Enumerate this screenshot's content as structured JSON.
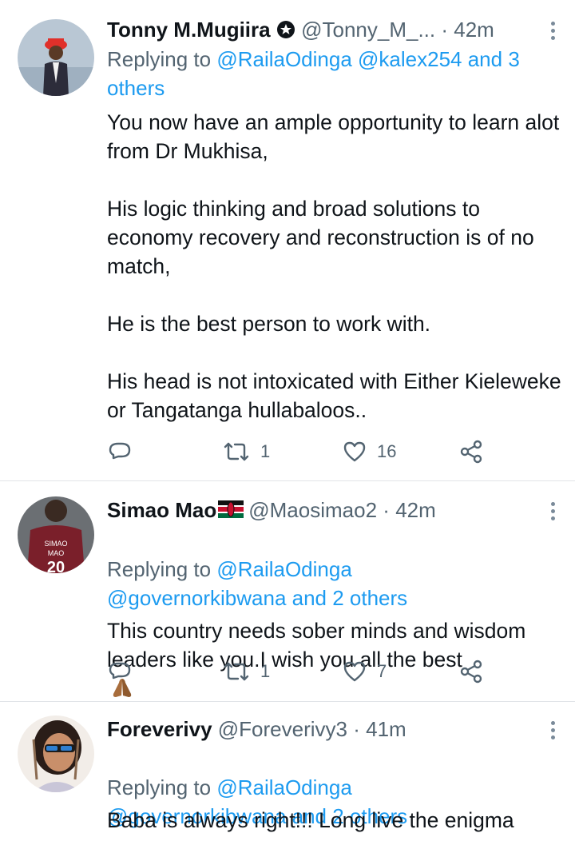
{
  "tweets": [
    {
      "name": "Tonny M.Mugiira",
      "handle": "@Tonny_M_...",
      "time": "42m",
      "reply_prefix": "Replying to",
      "reply_targets": "@RailaOdinga @kalex254 and 3 others",
      "text": "You now have an ample opportunity to learn alot from Dr Mukhisa,\n\nHis logic thinking and broad solutions to economy recovery and reconstruction is of no match,\n\nHe is the best person to work with.\n\nHis head is not intoxicated with Either Kieleweke or Tangatanga hullabaloos..",
      "retweets": "1",
      "likes": "16"
    },
    {
      "name": "Simao Mao",
      "flag": "kenya-flag-emoji",
      "handle": "@Maosimao2",
      "time": "42m",
      "avatar_text": "SIMAO\nMAO",
      "reply_prefix": "Replying to",
      "reply_targets": "@RailaOdinga\n@governorkibwana and 2 others",
      "text": "This country needs sober minds and wisdom leaders like you.I wish you all the best",
      "emoji": "folded-hands-emoji",
      "retweets": "1",
      "likes": "7"
    },
    {
      "name": "Foreverivy",
      "handle": "@Foreverivy3",
      "time": "41m",
      "reply_prefix": "Replying to",
      "reply_targets": "@RailaOdinga\n@governorkibwana and 2 others",
      "text": "Baba is always right!!! Long live the enigma"
    }
  ],
  "colors": {
    "link": "#1d9bf0",
    "muted": "#536471",
    "text": "#0f1419"
  },
  "icons": [
    "more-vertical-icon",
    "reply-icon",
    "retweet-icon",
    "like-icon",
    "share-icon",
    "verified-badge-icon"
  ]
}
